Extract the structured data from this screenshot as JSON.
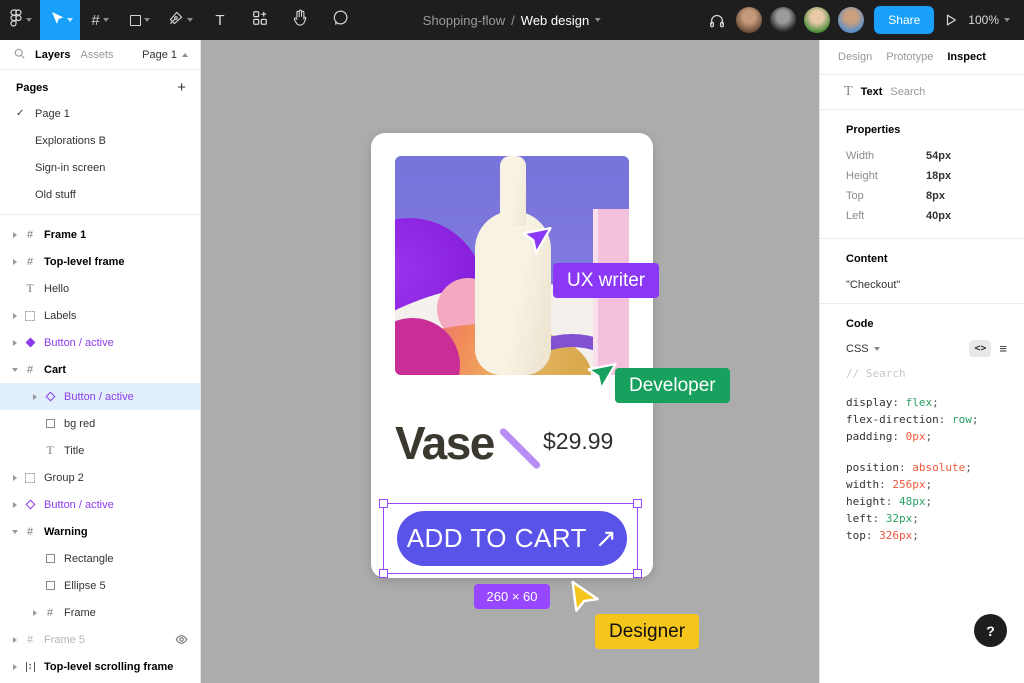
{
  "toolbar": {
    "title_project": "Shopping-flow",
    "title_separator": "/",
    "title_page": "Web design",
    "share_label": "Share",
    "zoom_level": "100%",
    "tools": [
      "figma-menu",
      "move-tool",
      "frame-tool",
      "shape-tool",
      "pen-tool",
      "text-tool",
      "resources-tool",
      "hand-tool",
      "comment-tool"
    ],
    "active_tool": "move-tool",
    "active_tool_color": "#18A0FB",
    "avatars": [
      {
        "name": "avatar-1",
        "face": "#c49a7a",
        "bg": "#6e4f3a"
      },
      {
        "name": "avatar-2",
        "face": "#9a9a9a",
        "bg": "#222222"
      },
      {
        "name": "avatar-3",
        "face": "#e8c9a8",
        "bg": "#4e8f3e"
      },
      {
        "name": "avatar-4",
        "face": "#caa07e",
        "bg": "#5b8fc9"
      }
    ]
  },
  "left_sidebar": {
    "tabs": [
      "Layers",
      "Assets"
    ],
    "active_tab": "Layers",
    "page_selector": "Page 1",
    "pages_header": "Pages",
    "pages": [
      {
        "name": "Page 1",
        "active": true
      },
      {
        "name": "Explorations B",
        "active": false
      },
      {
        "name": "Sign-in screen",
        "active": false
      },
      {
        "name": "Old stuff",
        "active": false
      }
    ],
    "layers": [
      {
        "name": "Frame 1",
        "icon": "frame",
        "caret": "closed",
        "bold": true,
        "depth": 0
      },
      {
        "name": "Top-level frame",
        "icon": "frame",
        "caret": "closed",
        "bold": true,
        "depth": 0
      },
      {
        "name": "Hello",
        "icon": "text",
        "caret": "none",
        "depth": 0
      },
      {
        "name": "Labels",
        "icon": "group",
        "caret": "closed",
        "depth": 0
      },
      {
        "name": "Button / active",
        "icon": "component",
        "caret": "closed",
        "purple": true,
        "depth": 0
      },
      {
        "name": "Cart",
        "icon": "frame",
        "caret": "open",
        "bold": true,
        "depth": 0
      },
      {
        "name": "Button / active",
        "icon": "instance",
        "caret": "closed",
        "purple": true,
        "selected": true,
        "depth": 1
      },
      {
        "name": "bg red",
        "icon": "rect",
        "caret": "none",
        "depth": 1
      },
      {
        "name": "Title",
        "icon": "text",
        "caret": "none",
        "depth": 1
      },
      {
        "name": "Group 2",
        "icon": "group",
        "caret": "closed",
        "depth": 0
      },
      {
        "name": "Button / active",
        "icon": "instance",
        "caret": "closed",
        "purple": true,
        "depth": 0
      },
      {
        "name": "Warning",
        "icon": "frame",
        "caret": "open",
        "bold": true,
        "depth": 0
      },
      {
        "name": "Rectangle",
        "icon": "rect",
        "caret": "none",
        "depth": 1
      },
      {
        "name": "Ellipse 5",
        "icon": "rect",
        "caret": "none",
        "depth": 1
      },
      {
        "name": "Frame",
        "icon": "frame",
        "caret": "closed",
        "depth": 1
      },
      {
        "name": "Frame 5",
        "icon": "frame",
        "caret": "closed",
        "hidden": true,
        "depth": 0
      },
      {
        "name": "Top-level scrolling frame",
        "icon": "scroll",
        "caret": "closed",
        "bold": true,
        "depth": 0
      }
    ]
  },
  "canvas": {
    "card": {
      "product_name": "Vase",
      "price": "$29.99",
      "cta_label": "ADD TO CART",
      "cta_arrow": "↗",
      "cta_color": "#5A53E9"
    },
    "selection": {
      "size_badge": "260 × 60",
      "accent_color": "#9747FF"
    },
    "cursors": [
      {
        "label": "UX writer",
        "color": "#8A38F6",
        "text_color": "#ffffff"
      },
      {
        "label": "Developer",
        "color": "#17A05E",
        "text_color": "#ffffff"
      },
      {
        "label": "Designer",
        "color": "#F5C51C",
        "text_color": "#111111"
      }
    ]
  },
  "right_sidebar": {
    "tabs": [
      "Design",
      "Prototype",
      "Inspect"
    ],
    "active_tab": "Inspect",
    "selection_row": {
      "type": "Text",
      "name": "Search"
    },
    "properties": {
      "header": "Properties",
      "rows": [
        {
          "label": "Width",
          "value": "54px"
        },
        {
          "label": "Height",
          "value": "18px"
        },
        {
          "label": "Top",
          "value": "8px"
        },
        {
          "label": "Left",
          "value": "40px"
        }
      ]
    },
    "content": {
      "header": "Content",
      "value": "\"Checkout\""
    },
    "code": {
      "header": "Code",
      "language": "CSS",
      "search_placeholder": "// Search",
      "value_colors": {
        "green": "#28A163",
        "red": "#F2583C"
      },
      "lines": [
        {
          "prop": "display",
          "value": "flex",
          "color": "green"
        },
        {
          "prop": "flex-direction",
          "value": "row",
          "color": "green"
        },
        {
          "prop": "padding",
          "value": "0px",
          "color": "red"
        },
        {
          "blank": true
        },
        {
          "prop": "position",
          "value": "absolute",
          "color": "red"
        },
        {
          "prop": "width",
          "value": "256px",
          "color": "red"
        },
        {
          "prop": "height",
          "value": "48px",
          "color": "green"
        },
        {
          "prop": "left",
          "value": "32px",
          "color": "green"
        },
        {
          "prop": "top",
          "value": "326px",
          "color": "red"
        }
      ]
    }
  },
  "help_button": "?"
}
